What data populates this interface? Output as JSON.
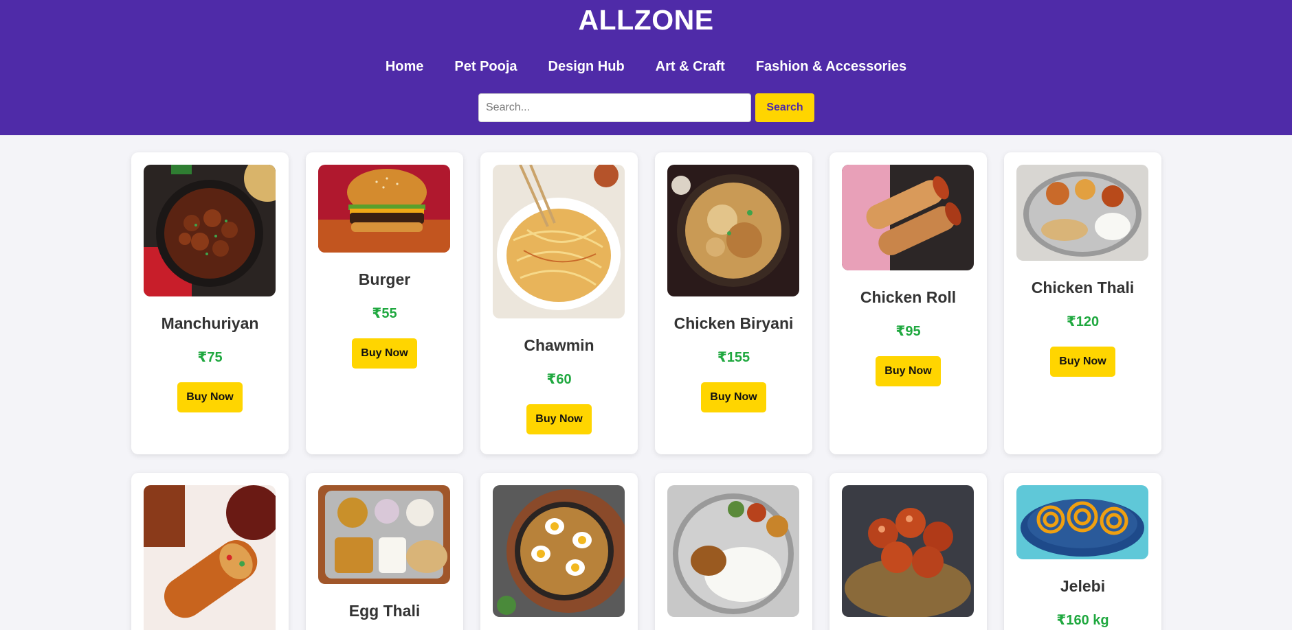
{
  "header": {
    "title": "ALLZONE",
    "nav": [
      "Home",
      "Pet Pooja",
      "Design Hub",
      "Art & Craft",
      "Fashion & Accessories"
    ],
    "search_placeholder": "Search...",
    "search_button": "Search",
    "bg_color": "#4f2ba8"
  },
  "buy_label": "Buy Now",
  "products": [
    {
      "name": "Manchuriyan",
      "price": "₹75",
      "icon": "manchurian-image"
    },
    {
      "name": "Burger",
      "price": "₹55",
      "icon": "burger-image"
    },
    {
      "name": "Chawmin",
      "price": "₹60",
      "icon": "chowmein-image"
    },
    {
      "name": "Chicken Biryani",
      "price": "₹155",
      "icon": "biryani-image"
    },
    {
      "name": "Chicken Roll",
      "price": "₹95",
      "icon": "chicken-roll-image"
    },
    {
      "name": "Chicken Thali",
      "price": "₹120",
      "icon": "chicken-thali-image"
    },
    {
      "name": "",
      "price": "",
      "icon": "roll-image"
    },
    {
      "name": "Egg Thali",
      "price": "",
      "icon": "egg-thali-image"
    },
    {
      "name": "",
      "price": "",
      "icon": "egg-biryani-image"
    },
    {
      "name": "",
      "price": "",
      "icon": "fish-thali-image"
    },
    {
      "name": "",
      "price": "",
      "icon": "gulab-jamun-image"
    },
    {
      "name": "Jelebi",
      "price": "₹160 kg",
      "icon": "jalebi-image"
    }
  ],
  "colors": {
    "accent": "#ffd500",
    "price": "#1fa83f"
  }
}
